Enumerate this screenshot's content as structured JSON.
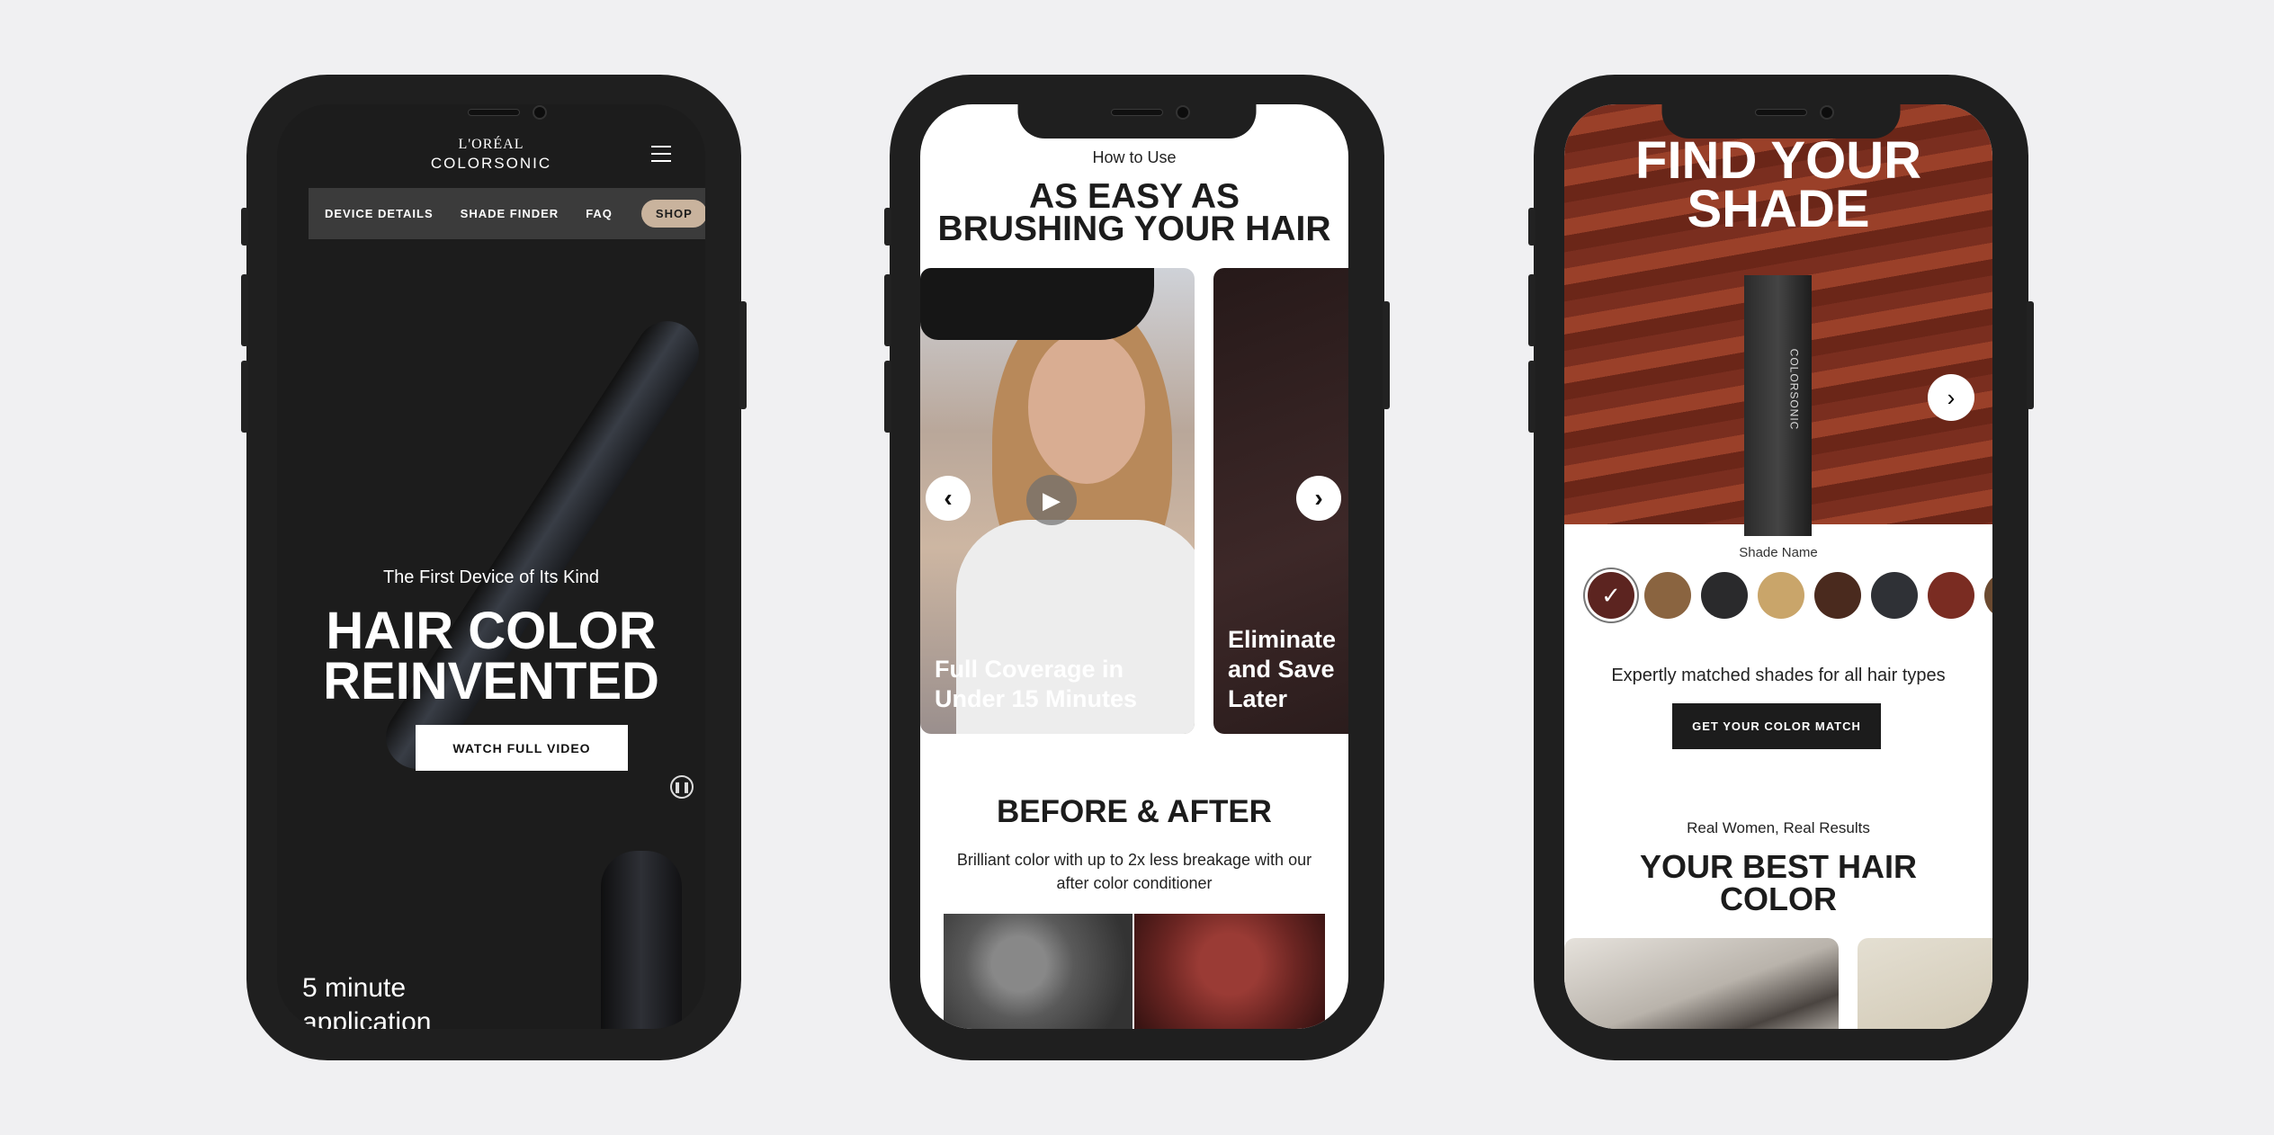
{
  "colors": {
    "background": "#f0f0f2",
    "dark": "#1c1c1c",
    "shop_accent": "#c9b39d",
    "nav": "#3b3b3b"
  },
  "phone1": {
    "logo_top": "L'ORÉAL",
    "logo_bottom": "COLORSONIC",
    "menu_icon": "hamburger-icon",
    "nav": [
      "DEVICE DETAILS",
      "SHADE FINDER",
      "FAQ"
    ],
    "shop": "SHOP",
    "kicker": "The First Device of Its Kind",
    "title_line1": "HAIR COLOR",
    "title_line2": "REINVENTED",
    "watch": "WATCH FULL VIDEO",
    "pause_icon": "pause-icon",
    "footer_line1": "5 minute",
    "footer_line2": "application"
  },
  "phone2": {
    "kicker": "How to Use",
    "title_line1": "AS EASY AS",
    "title_line2": "BRUSHING YOUR HAIR",
    "card1_line1": "Full Coverage in",
    "card1_line2": "Under 15 Minutes",
    "card2_line1": "Eliminate",
    "card2_line2": "and Save",
    "card2_line3": "Later",
    "before_after": "BEFORE & AFTER",
    "body": "Brilliant color with up to 2x less breakage with our after color conditioner"
  },
  "phone3": {
    "title_line1": "FIND YOUR",
    "title_line2": "SHADE",
    "box_label": "COLORSONIC",
    "shade_name": "Shade Name",
    "swatches": [
      "#5c2420",
      "#8a6440",
      "#2a2a2c",
      "#c9a56a",
      "#4a2a1e",
      "#2f3136",
      "#7a2c22",
      "#6b4a30"
    ],
    "subtitle": "Expertly matched shades for all hair types",
    "cta": "GET YOUR COLOR MATCH",
    "kicker": "Real Women, Real Results",
    "h2_line1": "YOUR BEST HAIR",
    "h2_line2": "COLOR"
  }
}
